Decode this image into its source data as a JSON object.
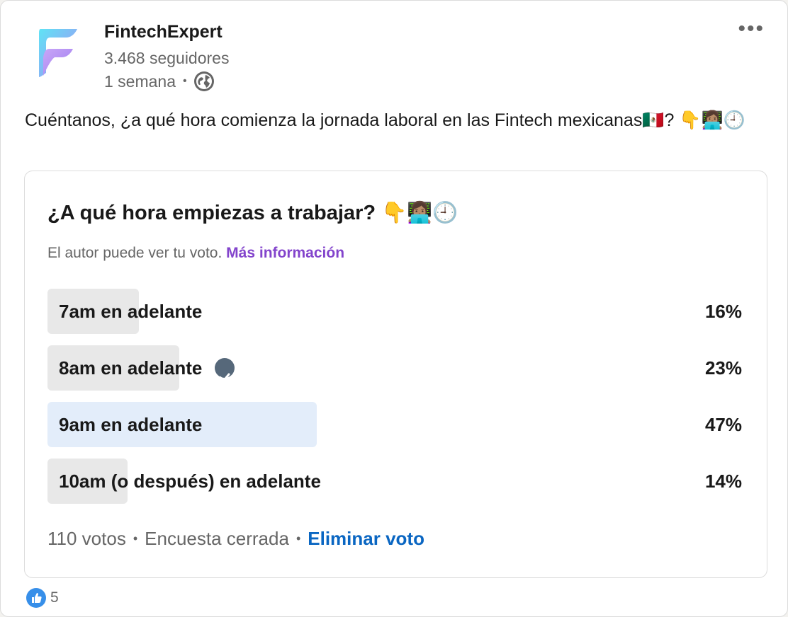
{
  "author": {
    "name": "FintechExpert",
    "followers": "3.468 seguidores",
    "time": "1 semana",
    "separator": "•",
    "visibility_icon": "globe-icon"
  },
  "menu_icon": "more-horizontal-icon",
  "post": {
    "text": "Cuéntanos, ¿a qué hora comienza la jornada laboral en las Fintech mexicanas🇲🇽? 👇👩🏽‍💻🕘"
  },
  "poll": {
    "question": "¿A qué hora empiezas a trabajar? 👇👩🏽‍💻🕘",
    "note": "El autor puede ver tu voto.",
    "note_link": "Más información",
    "options": [
      {
        "label": "7am en adelante",
        "percent": "16%",
        "value": 16,
        "selected": false,
        "voted": false
      },
      {
        "label": "8am en adelante",
        "percent": "23%",
        "value": 23,
        "selected": false,
        "voted": true
      },
      {
        "label": "9am en adelante",
        "percent": "47%",
        "value": 47,
        "selected": true,
        "voted": false
      },
      {
        "label": "10am (o después) en adelante",
        "percent": "14%",
        "value": 14,
        "selected": false,
        "voted": false
      }
    ],
    "votes": "110 votos",
    "status": "Encuesta cerrada",
    "separator": "•",
    "remove_vote": "Eliminar voto"
  },
  "reactions": {
    "icon": "like-icon",
    "count": "5"
  },
  "colors": {
    "accent_purple": "#8344cc",
    "link_blue": "#0a66c2",
    "selected_fill": "#e3edfa",
    "option_fill": "#e8e8e8"
  }
}
